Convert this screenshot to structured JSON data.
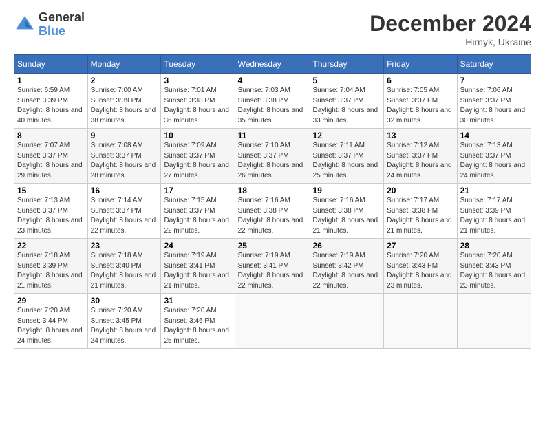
{
  "logo": {
    "general": "General",
    "blue": "Blue"
  },
  "header": {
    "title": "December 2024",
    "location": "Hirnyk, Ukraine"
  },
  "days_of_week": [
    "Sunday",
    "Monday",
    "Tuesday",
    "Wednesday",
    "Thursday",
    "Friday",
    "Saturday"
  ],
  "weeks": [
    [
      {
        "day": "1",
        "sunrise": "6:59 AM",
        "sunset": "3:39 PM",
        "daylight": "8 hours and 40 minutes."
      },
      {
        "day": "2",
        "sunrise": "7:00 AM",
        "sunset": "3:39 PM",
        "daylight": "8 hours and 38 minutes."
      },
      {
        "day": "3",
        "sunrise": "7:01 AM",
        "sunset": "3:38 PM",
        "daylight": "8 hours and 36 minutes."
      },
      {
        "day": "4",
        "sunrise": "7:03 AM",
        "sunset": "3:38 PM",
        "daylight": "8 hours and 35 minutes."
      },
      {
        "day": "5",
        "sunrise": "7:04 AM",
        "sunset": "3:37 PM",
        "daylight": "8 hours and 33 minutes."
      },
      {
        "day": "6",
        "sunrise": "7:05 AM",
        "sunset": "3:37 PM",
        "daylight": "8 hours and 32 minutes."
      },
      {
        "day": "7",
        "sunrise": "7:06 AM",
        "sunset": "3:37 PM",
        "daylight": "8 hours and 30 minutes."
      }
    ],
    [
      {
        "day": "8",
        "sunrise": "7:07 AM",
        "sunset": "3:37 PM",
        "daylight": "8 hours and 29 minutes."
      },
      {
        "day": "9",
        "sunrise": "7:08 AM",
        "sunset": "3:37 PM",
        "daylight": "8 hours and 28 minutes."
      },
      {
        "day": "10",
        "sunrise": "7:09 AM",
        "sunset": "3:37 PM",
        "daylight": "8 hours and 27 minutes."
      },
      {
        "day": "11",
        "sunrise": "7:10 AM",
        "sunset": "3:37 PM",
        "daylight": "8 hours and 26 minutes."
      },
      {
        "day": "12",
        "sunrise": "7:11 AM",
        "sunset": "3:37 PM",
        "daylight": "8 hours and 25 minutes."
      },
      {
        "day": "13",
        "sunrise": "7:12 AM",
        "sunset": "3:37 PM",
        "daylight": "8 hours and 24 minutes."
      },
      {
        "day": "14",
        "sunrise": "7:13 AM",
        "sunset": "3:37 PM",
        "daylight": "8 hours and 24 minutes."
      }
    ],
    [
      {
        "day": "15",
        "sunrise": "7:13 AM",
        "sunset": "3:37 PM",
        "daylight": "8 hours and 23 minutes."
      },
      {
        "day": "16",
        "sunrise": "7:14 AM",
        "sunset": "3:37 PM",
        "daylight": "8 hours and 22 minutes."
      },
      {
        "day": "17",
        "sunrise": "7:15 AM",
        "sunset": "3:37 PM",
        "daylight": "8 hours and 22 minutes."
      },
      {
        "day": "18",
        "sunrise": "7:16 AM",
        "sunset": "3:38 PM",
        "daylight": "8 hours and 22 minutes."
      },
      {
        "day": "19",
        "sunrise": "7:16 AM",
        "sunset": "3:38 PM",
        "daylight": "8 hours and 21 minutes."
      },
      {
        "day": "20",
        "sunrise": "7:17 AM",
        "sunset": "3:38 PM",
        "daylight": "8 hours and 21 minutes."
      },
      {
        "day": "21",
        "sunrise": "7:17 AM",
        "sunset": "3:39 PM",
        "daylight": "8 hours and 21 minutes."
      }
    ],
    [
      {
        "day": "22",
        "sunrise": "7:18 AM",
        "sunset": "3:39 PM",
        "daylight": "8 hours and 21 minutes."
      },
      {
        "day": "23",
        "sunrise": "7:18 AM",
        "sunset": "3:40 PM",
        "daylight": "8 hours and 21 minutes."
      },
      {
        "day": "24",
        "sunrise": "7:19 AM",
        "sunset": "3:41 PM",
        "daylight": "8 hours and 21 minutes."
      },
      {
        "day": "25",
        "sunrise": "7:19 AM",
        "sunset": "3:41 PM",
        "daylight": "8 hours and 22 minutes."
      },
      {
        "day": "26",
        "sunrise": "7:19 AM",
        "sunset": "3:42 PM",
        "daylight": "8 hours and 22 minutes."
      },
      {
        "day": "27",
        "sunrise": "7:20 AM",
        "sunset": "3:43 PM",
        "daylight": "8 hours and 23 minutes."
      },
      {
        "day": "28",
        "sunrise": "7:20 AM",
        "sunset": "3:43 PM",
        "daylight": "8 hours and 23 minutes."
      }
    ],
    [
      {
        "day": "29",
        "sunrise": "7:20 AM",
        "sunset": "3:44 PM",
        "daylight": "8 hours and 24 minutes."
      },
      {
        "day": "30",
        "sunrise": "7:20 AM",
        "sunset": "3:45 PM",
        "daylight": "8 hours and 24 minutes."
      },
      {
        "day": "31",
        "sunrise": "7:20 AM",
        "sunset": "3:46 PM",
        "daylight": "8 hours and 25 minutes."
      },
      null,
      null,
      null,
      null
    ]
  ],
  "labels": {
    "sunrise": "Sunrise:",
    "sunset": "Sunset:",
    "daylight": "Daylight:"
  }
}
